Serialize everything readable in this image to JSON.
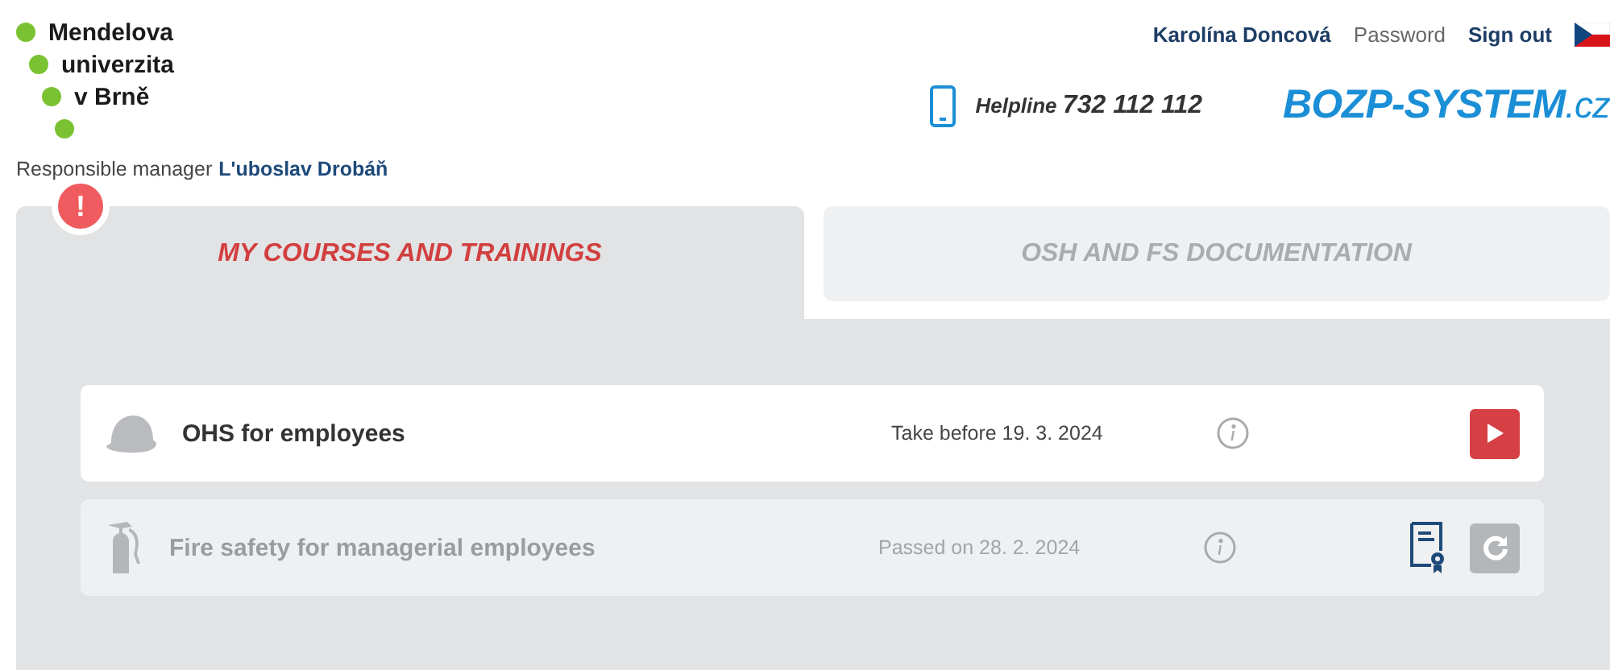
{
  "logo": {
    "lines": [
      "Mendelova",
      "univerzita",
      "v Brně"
    ]
  },
  "manager": {
    "label": "Responsible manager",
    "name": "L'uboslav Drobáň"
  },
  "user_menu": {
    "user": "Karolína Doncová",
    "password": "Password",
    "sign_out": "Sign out"
  },
  "helpline": {
    "label": "Helpline",
    "number": "732 112 112"
  },
  "brand": {
    "name": "BOZP-SYSTEM",
    "suffix": ".cz"
  },
  "tabs": [
    {
      "label": "MY COURSES AND TRAININGS",
      "selected": true,
      "alert": "!"
    },
    {
      "label": "OSH AND FS DOCUMENTATION",
      "selected": false
    }
  ],
  "courses": [
    {
      "kind": "helmet",
      "title": "OHS for employees",
      "passed": false,
      "date_text": "Take before 19. 3. 2024",
      "certificate": false
    },
    {
      "kind": "extinguisher",
      "title": "Fire safety for managerial employees",
      "passed": true,
      "date_text": "Passed on 28. 2. 2024",
      "certificate": true
    }
  ]
}
